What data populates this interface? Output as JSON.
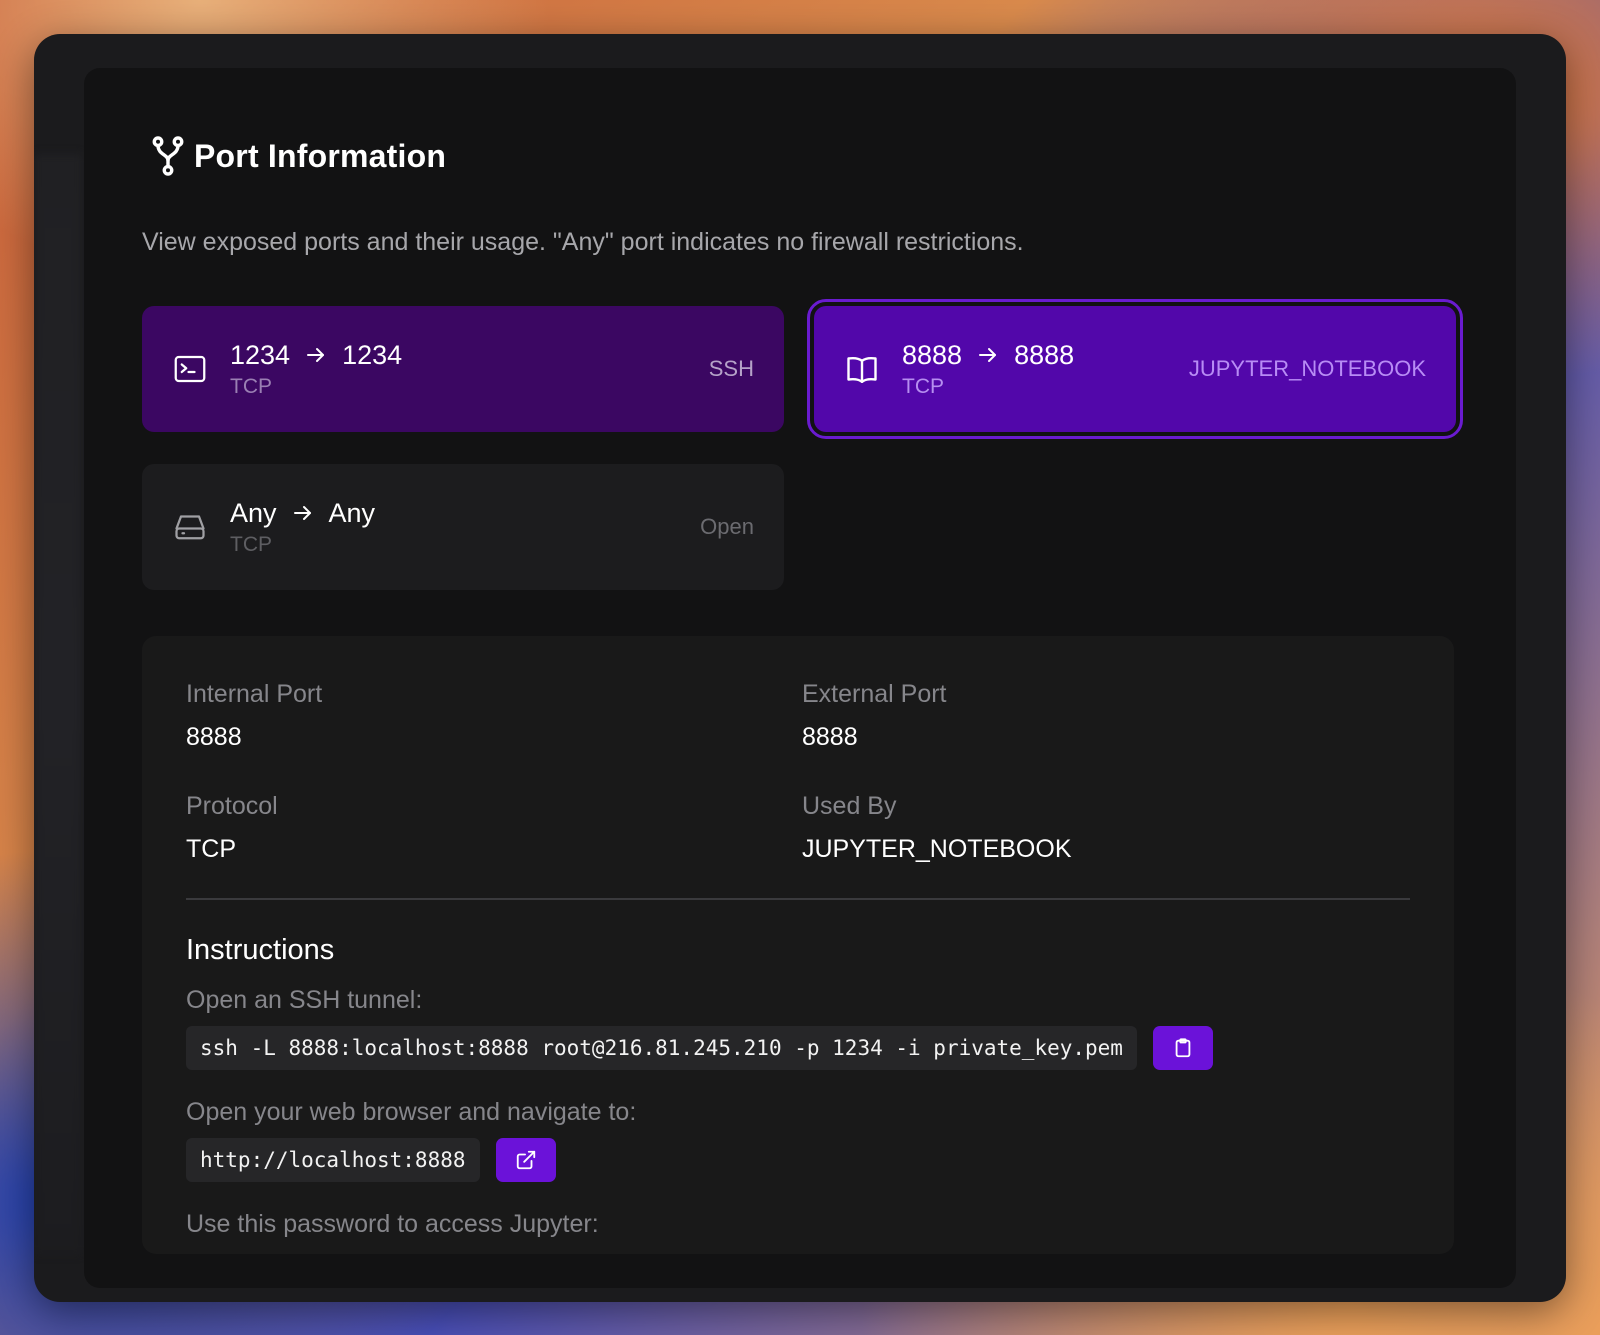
{
  "header": {
    "title": "Port Information",
    "subtitle": "View exposed ports and their usage. \"Any\" port indicates no firewall restrictions."
  },
  "port_cards": [
    {
      "internal": "1234",
      "external": "1234",
      "protocol": "TCP",
      "tag": "SSH",
      "icon": "terminal-icon",
      "selected": false
    },
    {
      "internal": "8888",
      "external": "8888",
      "protocol": "TCP",
      "tag": "JUPYTER_NOTEBOOK",
      "icon": "book-icon",
      "selected": true
    },
    {
      "internal": "Any",
      "external": "Any",
      "protocol": "TCP",
      "tag": "Open",
      "icon": "hard-drive-icon",
      "selected": false
    }
  ],
  "details": {
    "internal_port_label": "Internal Port",
    "internal_port_value": "8888",
    "external_port_label": "External Port",
    "external_port_value": "8888",
    "protocol_label": "Protocol",
    "protocol_value": "TCP",
    "used_by_label": "Used By",
    "used_by_value": "JUPYTER_NOTEBOOK"
  },
  "instructions": {
    "title": "Instructions",
    "ssh_label": "Open an SSH tunnel:",
    "ssh_command": "ssh -L 8888:localhost:8888 root@216.81.245.210 -p 1234 -i private_key.pem",
    "browser_label": "Open your web browser and navigate to:",
    "browser_url": "http://localhost:8888",
    "password_label": "Use this password to access Jupyter:"
  },
  "colors": {
    "accent": "#6b12d9",
    "selected_card": "#5207aa",
    "ssh_card": "#3b0762"
  }
}
